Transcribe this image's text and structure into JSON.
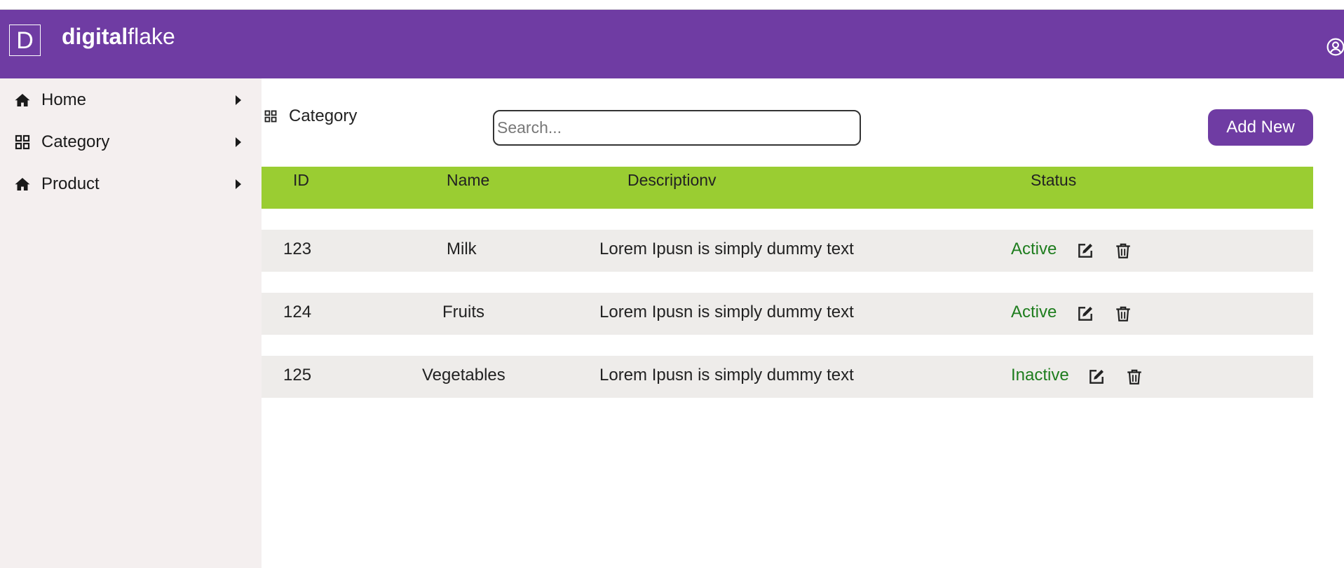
{
  "header": {
    "logo_letter": "D",
    "brand_bold": "digital",
    "brand_light": "flake",
    "bg_color": "#6f3ca3"
  },
  "sidebar": {
    "items": [
      {
        "label": "Home",
        "icon": "home-icon"
      },
      {
        "label": "Category",
        "icon": "grid-icon"
      },
      {
        "label": "Product",
        "icon": "home-icon"
      }
    ]
  },
  "main": {
    "page_title": "Category",
    "search_placeholder": "Search...",
    "add_button_label": "Add New",
    "table": {
      "header_color": "#9acd32",
      "columns": [
        "ID",
        "Name",
        "Descriptionv",
        "Status"
      ],
      "rows": [
        {
          "id": "123",
          "name": "Milk",
          "description": "Lorem Ipusn is simply dummy text",
          "status": "Active"
        },
        {
          "id": "124",
          "name": "Fruits",
          "description": "Lorem Ipusn is simply dummy text",
          "status": "Active"
        },
        {
          "id": "125",
          "name": "Vegetables",
          "description": "Lorem Ipusn is simply dummy text",
          "status": "Inactive"
        }
      ]
    }
  }
}
